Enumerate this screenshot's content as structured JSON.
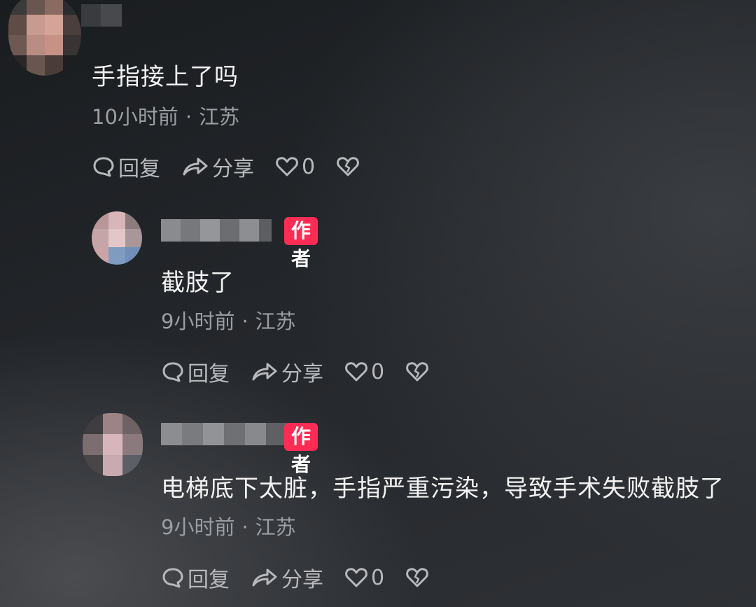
{
  "comments": [
    {
      "text": "手指接上了吗",
      "time": "10小时前",
      "separator": "·",
      "location": "江苏",
      "reply_label": "回复",
      "share_label": "分享",
      "like_count": "0",
      "is_author": false
    },
    {
      "author_tag": "作者",
      "text": "截肢了",
      "time": "9小时前",
      "separator": "·",
      "location": "江苏",
      "reply_label": "回复",
      "share_label": "分享",
      "like_count": "0",
      "is_author": true
    },
    {
      "author_tag": "作者",
      "text": "电梯底下太脏，手指严重污染，导致手术失败截肢了",
      "time": "9小时前",
      "separator": "·",
      "location": "江苏",
      "reply_label": "回复",
      "share_label": "分享",
      "like_count": "0",
      "is_author": true
    }
  ],
  "colors": {
    "author_tag": "#fe2c55",
    "meta_text": "#9b9ea3",
    "content_text": "#f2f2f2",
    "action_text": "#b7b9bd"
  },
  "icons": {
    "reply": "comment-bubble-icon",
    "share": "share-arrow-icon",
    "like": "heart-icon",
    "dislike": "broken-heart-icon"
  }
}
